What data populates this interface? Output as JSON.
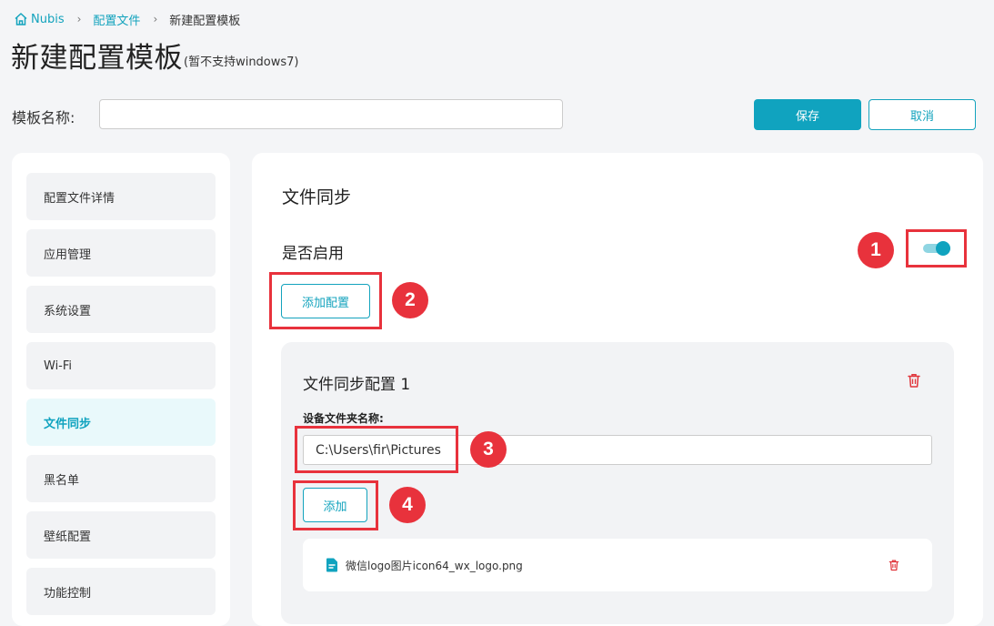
{
  "breadcrumb": {
    "home": "Nubis",
    "parent": "配置文件",
    "current": "新建配置模板"
  },
  "page": {
    "title": "新建配置模板",
    "title_note": "(暂不支持windows7)"
  },
  "template_name": {
    "label": "模板名称:",
    "value": "",
    "placeholder": ""
  },
  "actions": {
    "save": "保存",
    "cancel": "取消"
  },
  "sidebar": {
    "items": [
      {
        "label": "配置文件详情",
        "active": false
      },
      {
        "label": "应用管理",
        "active": false
      },
      {
        "label": "系统设置",
        "active": false
      },
      {
        "label": "Wi-Fi",
        "active": false
      },
      {
        "label": "文件同步",
        "active": true
      },
      {
        "label": "黑名单",
        "active": false
      },
      {
        "label": "壁纸配置",
        "active": false
      },
      {
        "label": "功能控制",
        "active": false
      }
    ]
  },
  "main": {
    "section_title": "文件同步",
    "enable_label": "是否启用",
    "enabled": true,
    "add_config_label": "添加配置",
    "config": {
      "title": "文件同步配置 1",
      "folder_label": "设备文件夹名称:",
      "folder_value": "C:\\Users\\fir\\Pictures",
      "add_label": "添加",
      "files": [
        {
          "name": "微信logo图片icon64_wx_logo.png"
        }
      ]
    }
  },
  "annotations": [
    "1",
    "2",
    "3",
    "4"
  ],
  "colors": {
    "accent": "#10a3bf",
    "annotation": "#e8323c",
    "danger": "#e0353b"
  }
}
